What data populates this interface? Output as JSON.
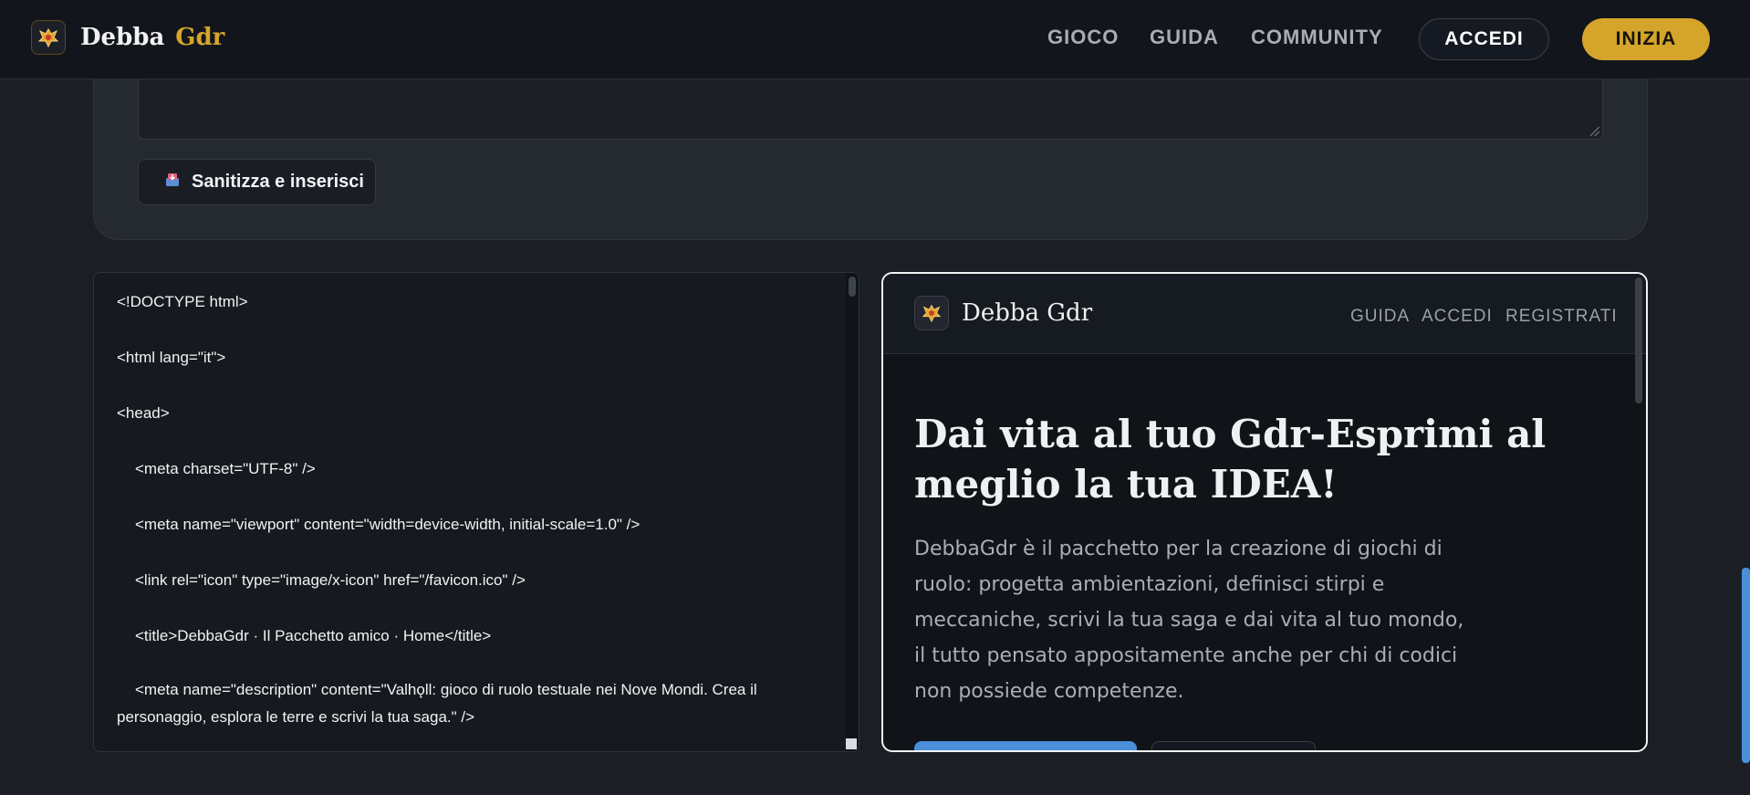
{
  "header": {
    "brand_a": "Debba",
    "brand_b": "Gdr",
    "nav": [
      "GIOCO",
      "GUIDA",
      "COMMUNITY"
    ],
    "accedi": "ACCEDI",
    "inizia": "INIZIA"
  },
  "editor": {
    "sanitize_label": "Sanitizza e inserisci",
    "sanitize_icon": "inbox-tray-icon"
  },
  "code": {
    "lines": [
      "<!DOCTYPE html>",
      "<html lang=\"it\">",
      "<head>",
      "<meta charset=\"UTF-8\" />",
      "<meta name=\"viewport\" content=\"width=device-width, initial-scale=1.0\" />",
      "<link rel=\"icon\" type=\"image/x-icon\" href=\"/favicon.ico\" />",
      "<title>DebbaGdr · Il Pacchetto amico · Home</title>",
      "<meta name=\"description\" content=\"Valhǫll: gioco di ruolo testuale nei Nove Mondi. Crea il personaggio, esplora le terre e scrivi la tua saga.\" />"
    ]
  },
  "preview": {
    "brand": "Debba Gdr",
    "nav": [
      "GUIDA",
      "ACCEDI",
      "REGISTRATI"
    ],
    "title": "Dai vita al tuo Gdr-Esprimi al meglio la tua IDEA!",
    "description": "DebbaGdr è il pacchetto per la creazione di giochi di ruolo: progetta ambientazioni, definisci stirpi e meccaniche, scrivi la tua saga e dai vita al tuo mondo, il tutto pensato appositamente anche per chi di codici non possiede competenze."
  },
  "colors": {
    "accent_gold": "#d4a52a",
    "accent_blue": "#4a8fd8",
    "background": "#1b1f25"
  }
}
